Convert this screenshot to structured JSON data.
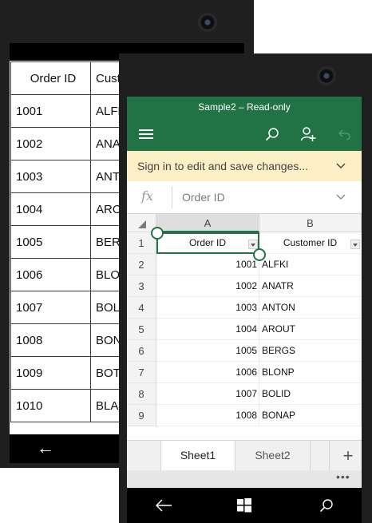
{
  "back_phone": {
    "table": {
      "headers": [
        "Order ID",
        "Customer ID"
      ],
      "rows": [
        [
          "1001",
          "ALFKI"
        ],
        [
          "1002",
          "ANATR"
        ],
        [
          "1003",
          "ANTON"
        ],
        [
          "1004",
          "AROUT"
        ],
        [
          "1005",
          "BERGS"
        ],
        [
          "1006",
          "BLONP"
        ],
        [
          "1007",
          "BOLID"
        ],
        [
          "1008",
          "BONAP"
        ],
        [
          "1009",
          "BOTTM"
        ],
        [
          "1010",
          "BLAUS"
        ]
      ]
    },
    "nav": {
      "back_icon": "back-arrow-icon"
    }
  },
  "app": {
    "title": "Sample2 – Read-only",
    "accent_color": "#217346",
    "infobar_message": "Sign in to edit and save changes...",
    "formula": {
      "fx_label": "fx",
      "value": "Order ID"
    },
    "columns": [
      "A",
      "B"
    ],
    "rows": [
      {
        "num": "1",
        "a": "Order ID",
        "b": "Customer ID"
      },
      {
        "num": "2",
        "a": "1001",
        "b": "ALFKI"
      },
      {
        "num": "3",
        "a": "1002",
        "b": "ANATR"
      },
      {
        "num": "4",
        "a": "1003",
        "b": "ANTON"
      },
      {
        "num": "5",
        "a": "1004",
        "b": "AROUT"
      },
      {
        "num": "6",
        "a": "1005",
        "b": "BERGS"
      },
      {
        "num": "7",
        "a": "1006",
        "b": "BLONP"
      },
      {
        "num": "8",
        "a": "1007",
        "b": "BOLID"
      },
      {
        "num": "9",
        "a": "1008",
        "b": "BONAP"
      }
    ],
    "sheets": [
      "Sheet1",
      "Sheet2"
    ],
    "add_sheet_label": "+",
    "more_label": "•••"
  }
}
